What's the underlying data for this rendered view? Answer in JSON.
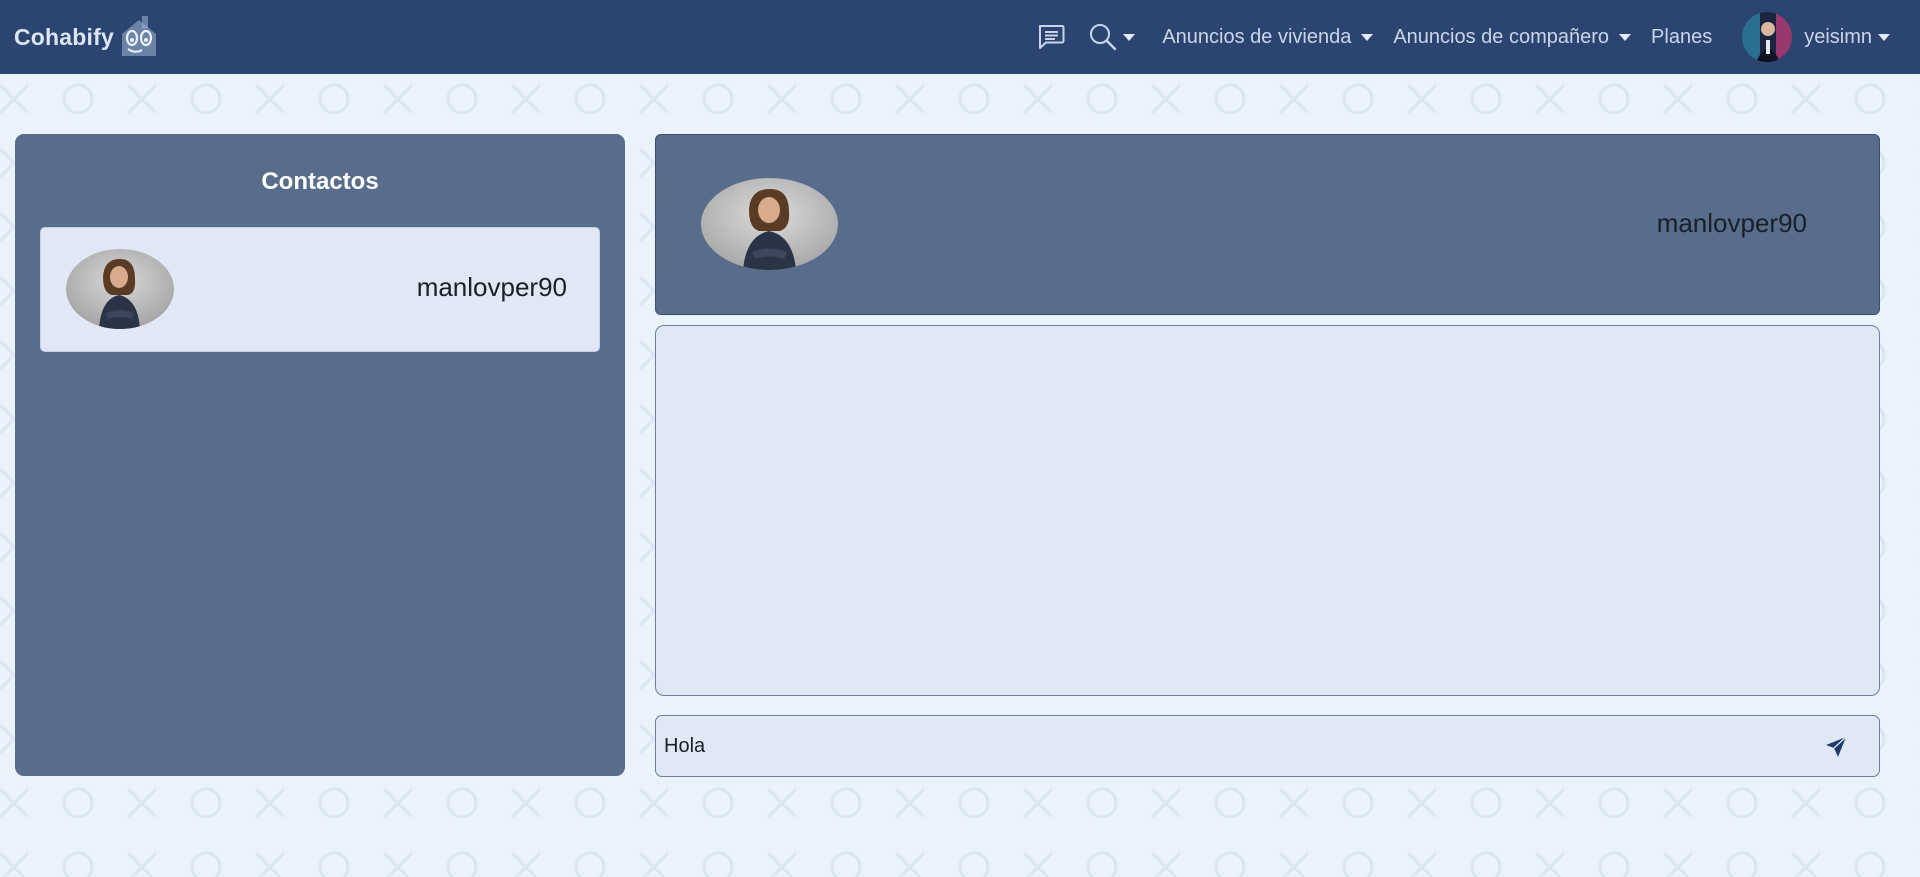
{
  "navbar": {
    "brand": "Cohabify",
    "links": {
      "vivienda": "Anuncios de vivienda",
      "companero": "Anuncios de compañero",
      "planes": "Planes"
    },
    "user": {
      "name": "yeisimn"
    },
    "icons": [
      "chat-icon",
      "search-icon"
    ]
  },
  "contacts": {
    "title": "Contactos",
    "items": [
      {
        "name": "manlovper90"
      }
    ]
  },
  "chat": {
    "contact_name": "manlovper90",
    "messages": [],
    "composer": {
      "value": "Hola"
    },
    "send_icon": "send-icon"
  },
  "colors": {
    "navbar": "#2b4570",
    "panel": "#586d8c",
    "card": "#e1e7f4",
    "background": "#eaf3fc",
    "send_icon": "#1e3a6e"
  }
}
